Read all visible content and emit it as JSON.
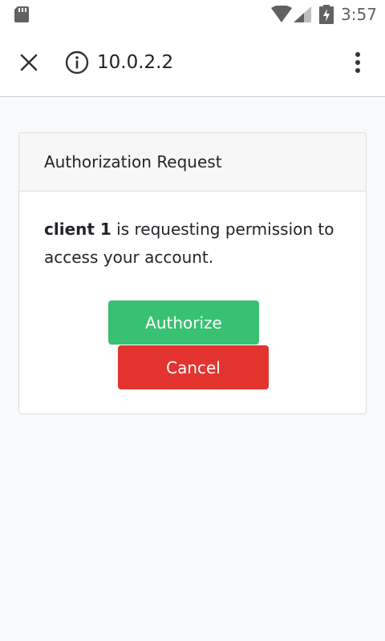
{
  "status_bar": {
    "time": "3:57",
    "icons": [
      "sd-card-icon",
      "wifi-icon",
      "signal-icon",
      "battery-charging-icon"
    ]
  },
  "browser": {
    "url": "10.0.2.2",
    "icons": [
      "close-icon",
      "info-icon",
      "more-vert-icon"
    ]
  },
  "card": {
    "title": "Authorization Request",
    "client_name": "client 1",
    "message": " is requesting permission to access your account.",
    "authorize_label": "Authorize",
    "cancel_label": "Cancel"
  },
  "colors": {
    "authorize": "#38c172",
    "cancel": "#e3342f",
    "page_background": "#f8f9fb"
  }
}
